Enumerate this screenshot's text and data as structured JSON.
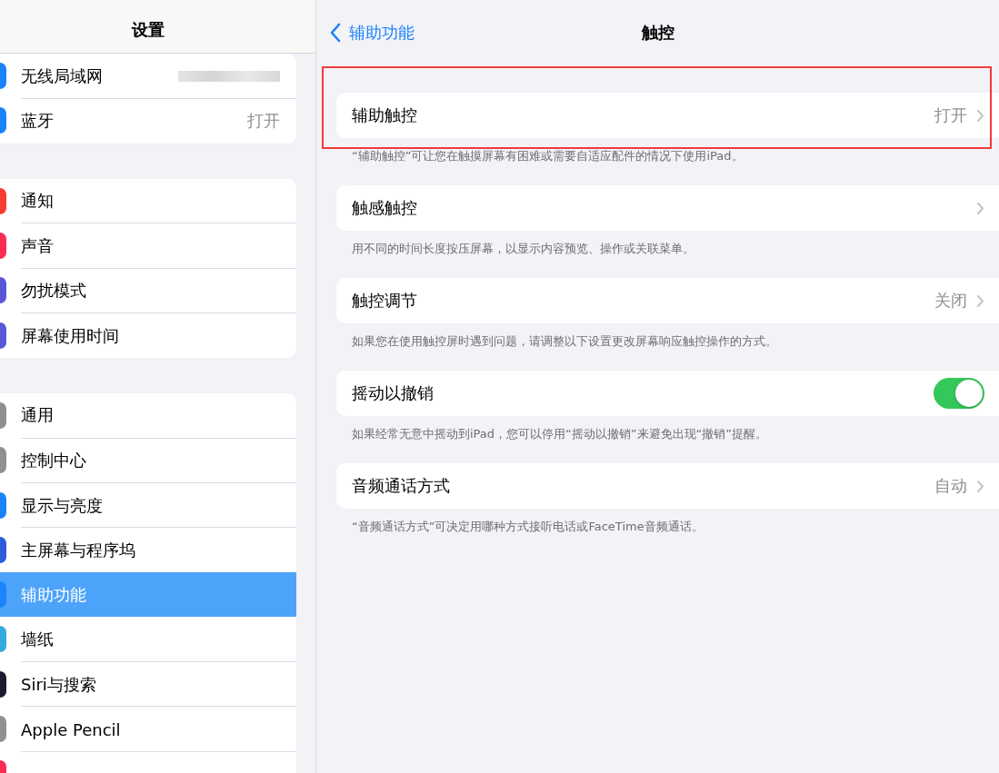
{
  "sidebar": {
    "title": "设置",
    "groups": [
      {
        "items": [
          {
            "label": "无线局域网",
            "color": "#1a82fb",
            "value_blurred": true,
            "selected": false
          },
          {
            "label": "蓝牙",
            "color": "#1a82fb",
            "value": "打开",
            "selected": false
          }
        ]
      },
      {
        "items": [
          {
            "label": "通知",
            "color": "#fb3b30",
            "selected": false
          },
          {
            "label": "声音",
            "color": "#fb2d55",
            "selected": false
          },
          {
            "label": "勿扰模式",
            "color": "#5856d6",
            "selected": false
          },
          {
            "label": "屏幕使用时间",
            "color": "#5a57d8",
            "selected": false
          }
        ]
      },
      {
        "items": [
          {
            "label": "通用",
            "color": "#8e8e93",
            "selected": false
          },
          {
            "label": "控制中心",
            "color": "#8f8f94",
            "selected": false
          },
          {
            "label": "显示与亮度",
            "color": "#1b83fa",
            "selected": false
          },
          {
            "label": "主屏幕与程序坞",
            "color": "#2d5cdb",
            "selected": false
          },
          {
            "label": "辅助功能",
            "color": "#1c84fc",
            "selected": true
          },
          {
            "label": "墙纸",
            "color": "#36aadc",
            "selected": false
          },
          {
            "label": "Siri与搜索",
            "color": "#1c1c2e",
            "selected": false
          },
          {
            "label": "Apple Pencil",
            "color": "#909095",
            "selected": false
          },
          {
            "color": "#fb2d56",
            "selected": false
          }
        ]
      }
    ]
  },
  "detail": {
    "back": "辅助功能",
    "title": "触控",
    "sections": [
      {
        "kind": "link",
        "label": "辅助触控",
        "value": "打开",
        "footer": "“辅助触控”可让您在触摸屏幕有困难或需要自适应配件的情况下使用iPad。",
        "highlighted": true
      },
      {
        "kind": "link",
        "label": "触感触控",
        "footer": "用不同的时间长度按压屏幕，以显示内容预览、操作或关联菜单。",
        "highlighted": false
      },
      {
        "kind": "link",
        "label": "触控调节",
        "value": "关闭",
        "footer": "如果您在使用触控屏时遇到问题，请调整以下设置更改屏幕响应触控操作的方式。",
        "highlighted": false
      },
      {
        "kind": "toggle",
        "label": "摇动以撤销",
        "on": true,
        "footer": "如果经常无意中摇动到iPad，您可以停用“摇动以撤销”来避免出现“撤销”提醒。",
        "highlighted": false
      },
      {
        "kind": "link",
        "label": "音频通话方式",
        "value": "自动",
        "footer": "“音频通话方式”可决定用哪种方式接听电话或FaceTime音频通话。",
        "highlighted": false
      }
    ]
  }
}
